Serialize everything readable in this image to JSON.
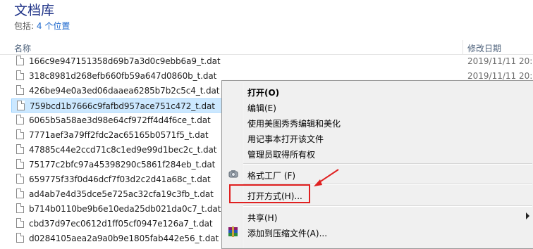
{
  "library": {
    "title": "文档库",
    "includes_label": "包括:",
    "includes_link": "4 个位置"
  },
  "columns": {
    "name": "名称",
    "date": "修改日期"
  },
  "files": [
    {
      "name": "166c9e947151358d69b7a3d0c9ebb6a9_t.dat",
      "date": "2019/11/11 20:5"
    },
    {
      "name": "318c8981d268efb660fb59a647d0860b_t.dat",
      "date": "2019/11/11 20:5"
    },
    {
      "name": "426be94e0a3ed06daaea6285b7b2c5c4_t.dat",
      "date": ""
    },
    {
      "name": "759bcd1b7666c9fafbd957ace751c472_t.dat",
      "date": ""
    },
    {
      "name": "6065b5a58ae3d98e64cf972ff4d4f6ce_t.dat",
      "date": ""
    },
    {
      "name": "7771aef3a79ff2fdc2ac65165b0571f5_t.dat",
      "date": ""
    },
    {
      "name": "47885c44e2ccd71c8c1ed9e99d1bec2c_t.dat",
      "date": ""
    },
    {
      "name": "75177c2bfc97a45398290c5861f284eb_t.dat",
      "date": ""
    },
    {
      "name": "659775f33f0d46dcf7f03d2c2d41a68c_t.dat",
      "date": ""
    },
    {
      "name": "ad4ab7e4d35dce5e725ac32cfa19c3fb_t.dat",
      "date": ""
    },
    {
      "name": "b714b0110be9b6e10eda25db021da0c7_t.dat",
      "date": ""
    },
    {
      "name": "cbd37d97ec0612d1ff05cf0947e126a7_t.dat",
      "date": ""
    },
    {
      "name": "d0284105aea2a9a0b9e1805fab442e56_t.dat",
      "date": ""
    }
  ],
  "selected_index": 3,
  "context_menu": {
    "items": [
      {
        "label": "打开(O)",
        "bold": true
      },
      {
        "label": "编辑(E)"
      },
      {
        "label": "使用美图秀秀编辑和美化"
      },
      {
        "label": "用记事本打开该文件"
      },
      {
        "label": "管理员取得所有权"
      },
      {
        "label": "格式工厂 (F)",
        "icon": "format-factory-icon"
      },
      {
        "label": "打开方式(H)..."
      },
      {
        "label": "共享(H)",
        "submenu": true
      },
      {
        "label": "添加到压缩文件(A)...",
        "icon": "winrar-icon"
      }
    ]
  },
  "colors": {
    "title": "#1e3287",
    "link": "#1a66cc",
    "selection": "#cce8ff",
    "annotation": "#e02020"
  }
}
